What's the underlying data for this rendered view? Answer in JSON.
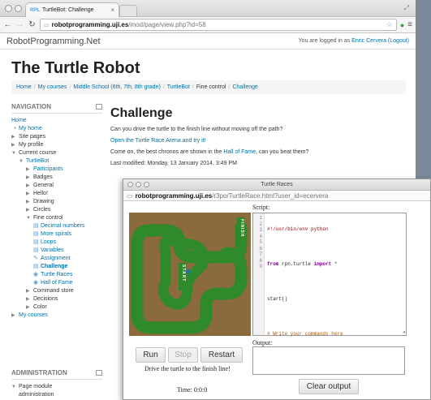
{
  "browser": {
    "tab_title": "TurtleBot: Challenge",
    "tab_favicon": "RPL",
    "url_host": "robotprogramming.uji.es",
    "url_path": "/mod/page/view.php?id=58"
  },
  "header": {
    "site_name": "RobotProgramming.Net",
    "login_prefix": "You are logged in as ",
    "user_name": "Enric Cervera",
    "logout": "(Logout)"
  },
  "course_title": "The Turtle Robot",
  "breadcrumb": {
    "items": [
      "Home",
      "My courses",
      "Middle School (6th, 7th, 8th grade)",
      "TurtleBot"
    ],
    "plain": "Fine control",
    "last": "Challenge"
  },
  "navigation": {
    "title": "NAVIGATION",
    "home": "Home",
    "my_home": "My home",
    "site_pages": "Site pages",
    "my_profile": "My profile",
    "current_course": "Current course",
    "turtlebot": "TurtleBot",
    "participants": "Participants",
    "badges": "Badges",
    "general": "General",
    "hello": "Hello!",
    "drawing": "Drawing",
    "circles": "Circles",
    "fine_control": "Fine control",
    "decimal_numbers": "Decimal numbers",
    "more_spirals": "More spirals",
    "loops": "Loops",
    "variables": "Variables",
    "assignment": "Assignment",
    "challenge": "Challenge",
    "turtle_races": "Turtle Races",
    "hall_of_fame": "Hall of Fame",
    "command_store": "Command store",
    "decisions": "Decisions",
    "color": "Color",
    "my_courses": "My courses"
  },
  "administration": {
    "title": "ADMINISTRATION",
    "page_module_line1": "Page module",
    "page_module_line2": "administration"
  },
  "main": {
    "title": "Challenge",
    "line1": "Can you drive the turtle to the finish line without moving off the path?",
    "link": "Open the Turtle Race Arena and try it!",
    "line2_prefix": "Come on, the best chronos are shown in the ",
    "hall_of_fame": "Hall of Fame",
    "line2_suffix": ", can you beat them?",
    "last_modified": "Last modified: Monday, 13 January 2014, 3:49 PM"
  },
  "popup": {
    "title": "Turtle Races",
    "url_host": "robotprogramming.uji.es",
    "url_path": "/r3po/TurtleRace.html?user_id=ecervera",
    "script_label": "Script:",
    "output_label": "Output:",
    "finish_text": "FINISH",
    "start_text": "START",
    "code": {
      "l1": "#!/usr/bin/env python",
      "l3_kw1": "from",
      "l3_mod": " rpn.turtle ",
      "l3_kw2": "import",
      "l3_rest": " *",
      "l5": "start()",
      "l7": "# Write your commands here"
    },
    "line_numbers": [
      "1",
      "2",
      "3",
      "4",
      "5",
      "6",
      "7",
      "8",
      "9"
    ],
    "run": "Run",
    "stop": "Stop",
    "reset": "Restart",
    "clear": "Clear output",
    "hint": "Drive the turtle to the finish line!",
    "timer": "Time: 0:0:0"
  }
}
